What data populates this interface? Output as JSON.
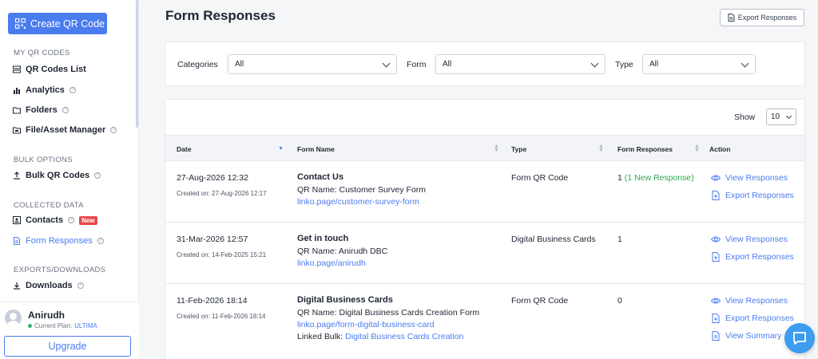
{
  "sidebar": {
    "create_button": "Create QR Code",
    "sections": {
      "my_qr": "MY QR CODES",
      "bulk": "BULK OPTIONS",
      "collected": "COLLECTED DATA",
      "exports": "EXPORTS/DOWNLOADS"
    },
    "items": {
      "qr_list": "QR Codes List",
      "analytics": "Analytics",
      "folders": "Folders",
      "file_manager": "File/Asset Manager",
      "bulk_qr": "Bulk QR Codes",
      "contacts": "Contacts",
      "contacts_badge": "New",
      "form_responses": "Form Responses",
      "downloads": "Downloads"
    },
    "user": {
      "name": "Anirudh",
      "plan_label": "Current Plan:",
      "plan_value": "ULTIMA",
      "upgrade": "Upgrade"
    }
  },
  "header": {
    "title": "Form Responses",
    "export_button": "Export Responses"
  },
  "filters": {
    "categories_label": "Categories",
    "categories_value": "All",
    "form_label": "Form",
    "form_value": "All",
    "type_label": "Type",
    "type_value": "All"
  },
  "table": {
    "show_label": "Show",
    "show_value": "10",
    "headers": {
      "date": "Date",
      "form_name": "Form Name",
      "type": "Type",
      "responses": "Form Responses",
      "action": "Action"
    },
    "actions": {
      "view": "View Responses",
      "export": "Export Responses",
      "summary": "View Summary"
    },
    "rows": [
      {
        "date": "27-Aug-2026 12:32",
        "created": "Created on: 27-Aug-2026 12:17",
        "form_title": "Contact Us",
        "qr_name": "QR Name: Customer Survey Form",
        "link": "linko.page/customer-survey-form",
        "type": "Form QR Code",
        "responses": "1",
        "responses_new": "(1 New Response)"
      },
      {
        "date": "31-Mar-2026 12:57",
        "created": "Created on: 14-Feb-2025 15:21",
        "form_title": "Get in touch",
        "qr_name": "QR Name: Anirudh DBC",
        "link": "linko.page/anirudh",
        "type": "Digital Business Cards",
        "responses": "1"
      },
      {
        "date": "11-Feb-2026 18:14",
        "created": "Created on: 11-Feb-2026 18:14",
        "form_title": "Digital Business Cards",
        "qr_name": "QR Name: Digital Business Cards Creation Form",
        "link": "linko.page/form-digital-business-card",
        "linked_label": "Linked Bulk:",
        "linked_value": "Digital Business Cards Creation",
        "type": "Form QR Code",
        "responses": "0"
      }
    ]
  },
  "colors": {
    "accent": "#4a7cf0",
    "success": "#2fa84f",
    "badge": "#e5484d"
  }
}
